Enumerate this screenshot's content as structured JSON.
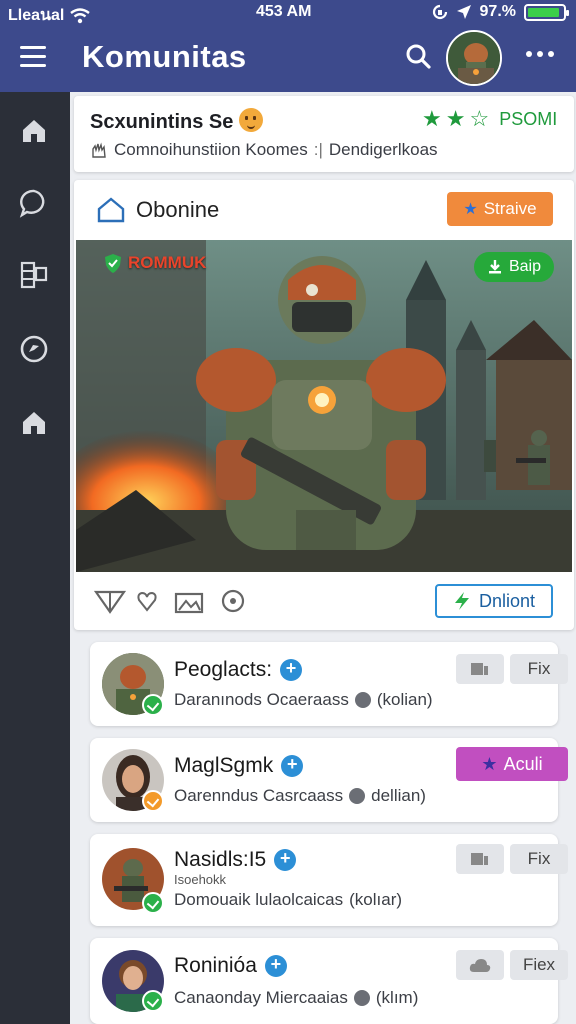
{
  "status_bar": {
    "carrier": "Lleaนal",
    "time": "453 AM",
    "battery": "97.%",
    "battery_level": 0.9
  },
  "app_bar": {
    "title": "Komunitas",
    "menu_icon": "hamburger-menu-icon",
    "search_icon": "search-icon",
    "more_icon": "more-horizontal-icon"
  },
  "side_rail": {
    "items": [
      {
        "icon": "home-icon"
      },
      {
        "icon": "chat-bubble-icon"
      },
      {
        "icon": "grid-icon"
      },
      {
        "icon": "compass-icon"
      },
      {
        "icon": "home-icon"
      }
    ]
  },
  "community": {
    "name": "Scxunintins Se",
    "rating_label": "PSOMI",
    "stars": 3,
    "sub_left": "Comnoihunstiion Koomes",
    "sub_right": "Dendigerlkoas"
  },
  "post": {
    "header_title": "Obonine",
    "header_button": "Straive",
    "image_tag": "ROMMUK",
    "image_button": "Baip",
    "action_button": "Dnliont",
    "colors": {
      "orange": "#f08a3c",
      "green": "#26a93a",
      "blue": "#2c8fd6"
    }
  },
  "members": [
    {
      "name": "Peoglacts:",
      "subtitle": "Daranınods Ocaeraass",
      "suffix": "(kolian)",
      "button": "Fix",
      "status": "online"
    },
    {
      "name": "MaglSgmk",
      "subtitle": "Oarenndus Casrcaass",
      "suffix": "dellian)",
      "button": "Aculi",
      "status": "away"
    },
    {
      "name": "Nasidls:I5",
      "note": "Isoehokk",
      "subtitle": "Domouaik lulaolcaicas",
      "suffix": "(kolıar)",
      "button": "Fix",
      "status": "online"
    },
    {
      "name": "Roninióa",
      "subtitle": "Canaonday Miercaaias",
      "suffix": "(klım)",
      "button": "Fiex",
      "status": "online"
    }
  ]
}
